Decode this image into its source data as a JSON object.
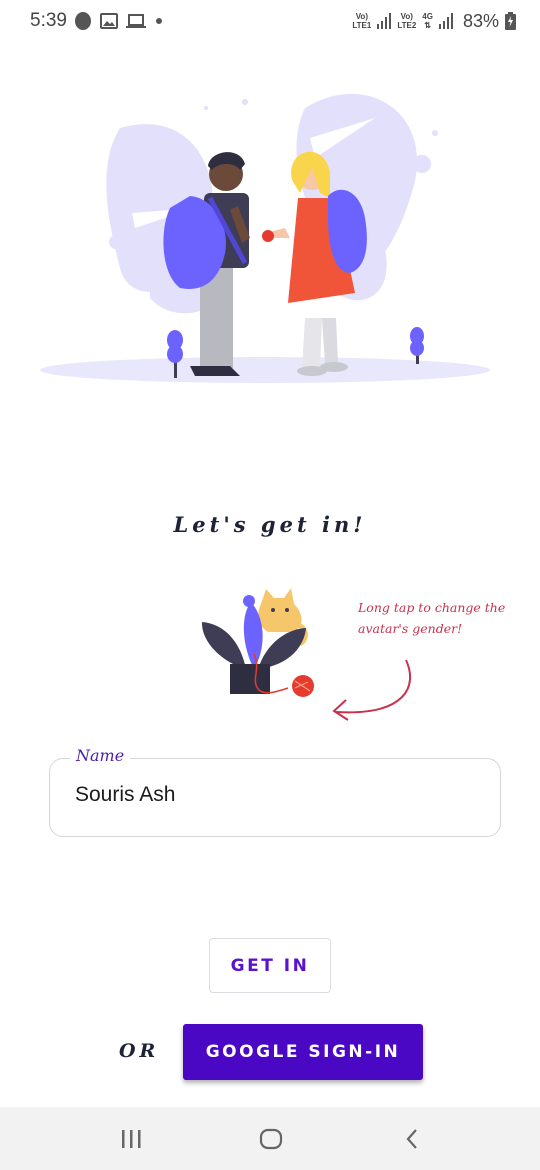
{
  "status_bar": {
    "time": "5:39",
    "left_icons": [
      "notification-blob-icon",
      "image-icon",
      "laptop-icon",
      "dot-icon"
    ],
    "sim1_label": [
      "Vo)",
      "LTE1"
    ],
    "sim2_label": [
      "Vo)",
      "LTE2"
    ],
    "network_type": "4G",
    "battery": "83%"
  },
  "welcome_text": "Let's get in!",
  "avatar": {
    "hint": "Long tap to change the avatar's gender!"
  },
  "name_field": {
    "label": "Name",
    "value": "Souris Ash"
  },
  "buttons": {
    "get_in": "GET IN",
    "or": "OR",
    "google": "GOOGLE SIGN-IN"
  },
  "colors": {
    "accent": "#4a08c5",
    "accent_text": "#5a12d0",
    "hint": "#c9314f",
    "illustration_light": "#e3e0fb",
    "illustration_mid": "#6c63ff"
  },
  "navbar": [
    "recent-apps-icon",
    "home-icon",
    "back-icon"
  ]
}
